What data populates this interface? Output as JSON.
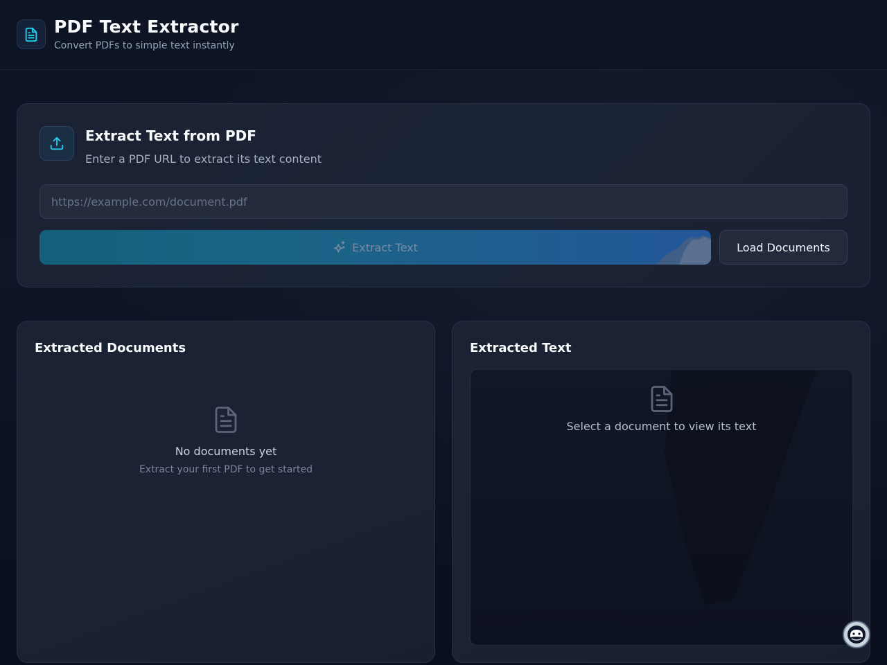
{
  "header": {
    "title": "PDF Text Extractor",
    "subtitle": "Convert PDFs to simple text instantly",
    "logo_icon": "file-text-icon"
  },
  "extract_card": {
    "icon": "upload-icon",
    "title": "Extract Text from PDF",
    "subtitle": "Enter a PDF URL to extract its text content",
    "url_input": {
      "value": "",
      "placeholder": "https://example.com/document.pdf"
    },
    "extract_button": {
      "label": "Extract Text",
      "icon": "sparkles-icon",
      "disabled": true
    },
    "load_button": {
      "label": "Load Documents"
    }
  },
  "documents_panel": {
    "title": "Extracted Documents",
    "empty_icon": "file-text-icon",
    "empty_title": "No documents yet",
    "empty_subtitle": "Extract your first PDF to get started"
  },
  "text_panel": {
    "title": "Extracted Text",
    "empty_icon": "file-text-icon",
    "empty_message": "Select a document to view its text"
  },
  "fab": {
    "icon": "assistant-icon"
  },
  "colors": {
    "background": "#0b1120",
    "card": "#1a2233",
    "accent_cyan": "#22d3ee",
    "button_gradient_start": "#13607e",
    "button_gradient_end": "#24579a"
  }
}
